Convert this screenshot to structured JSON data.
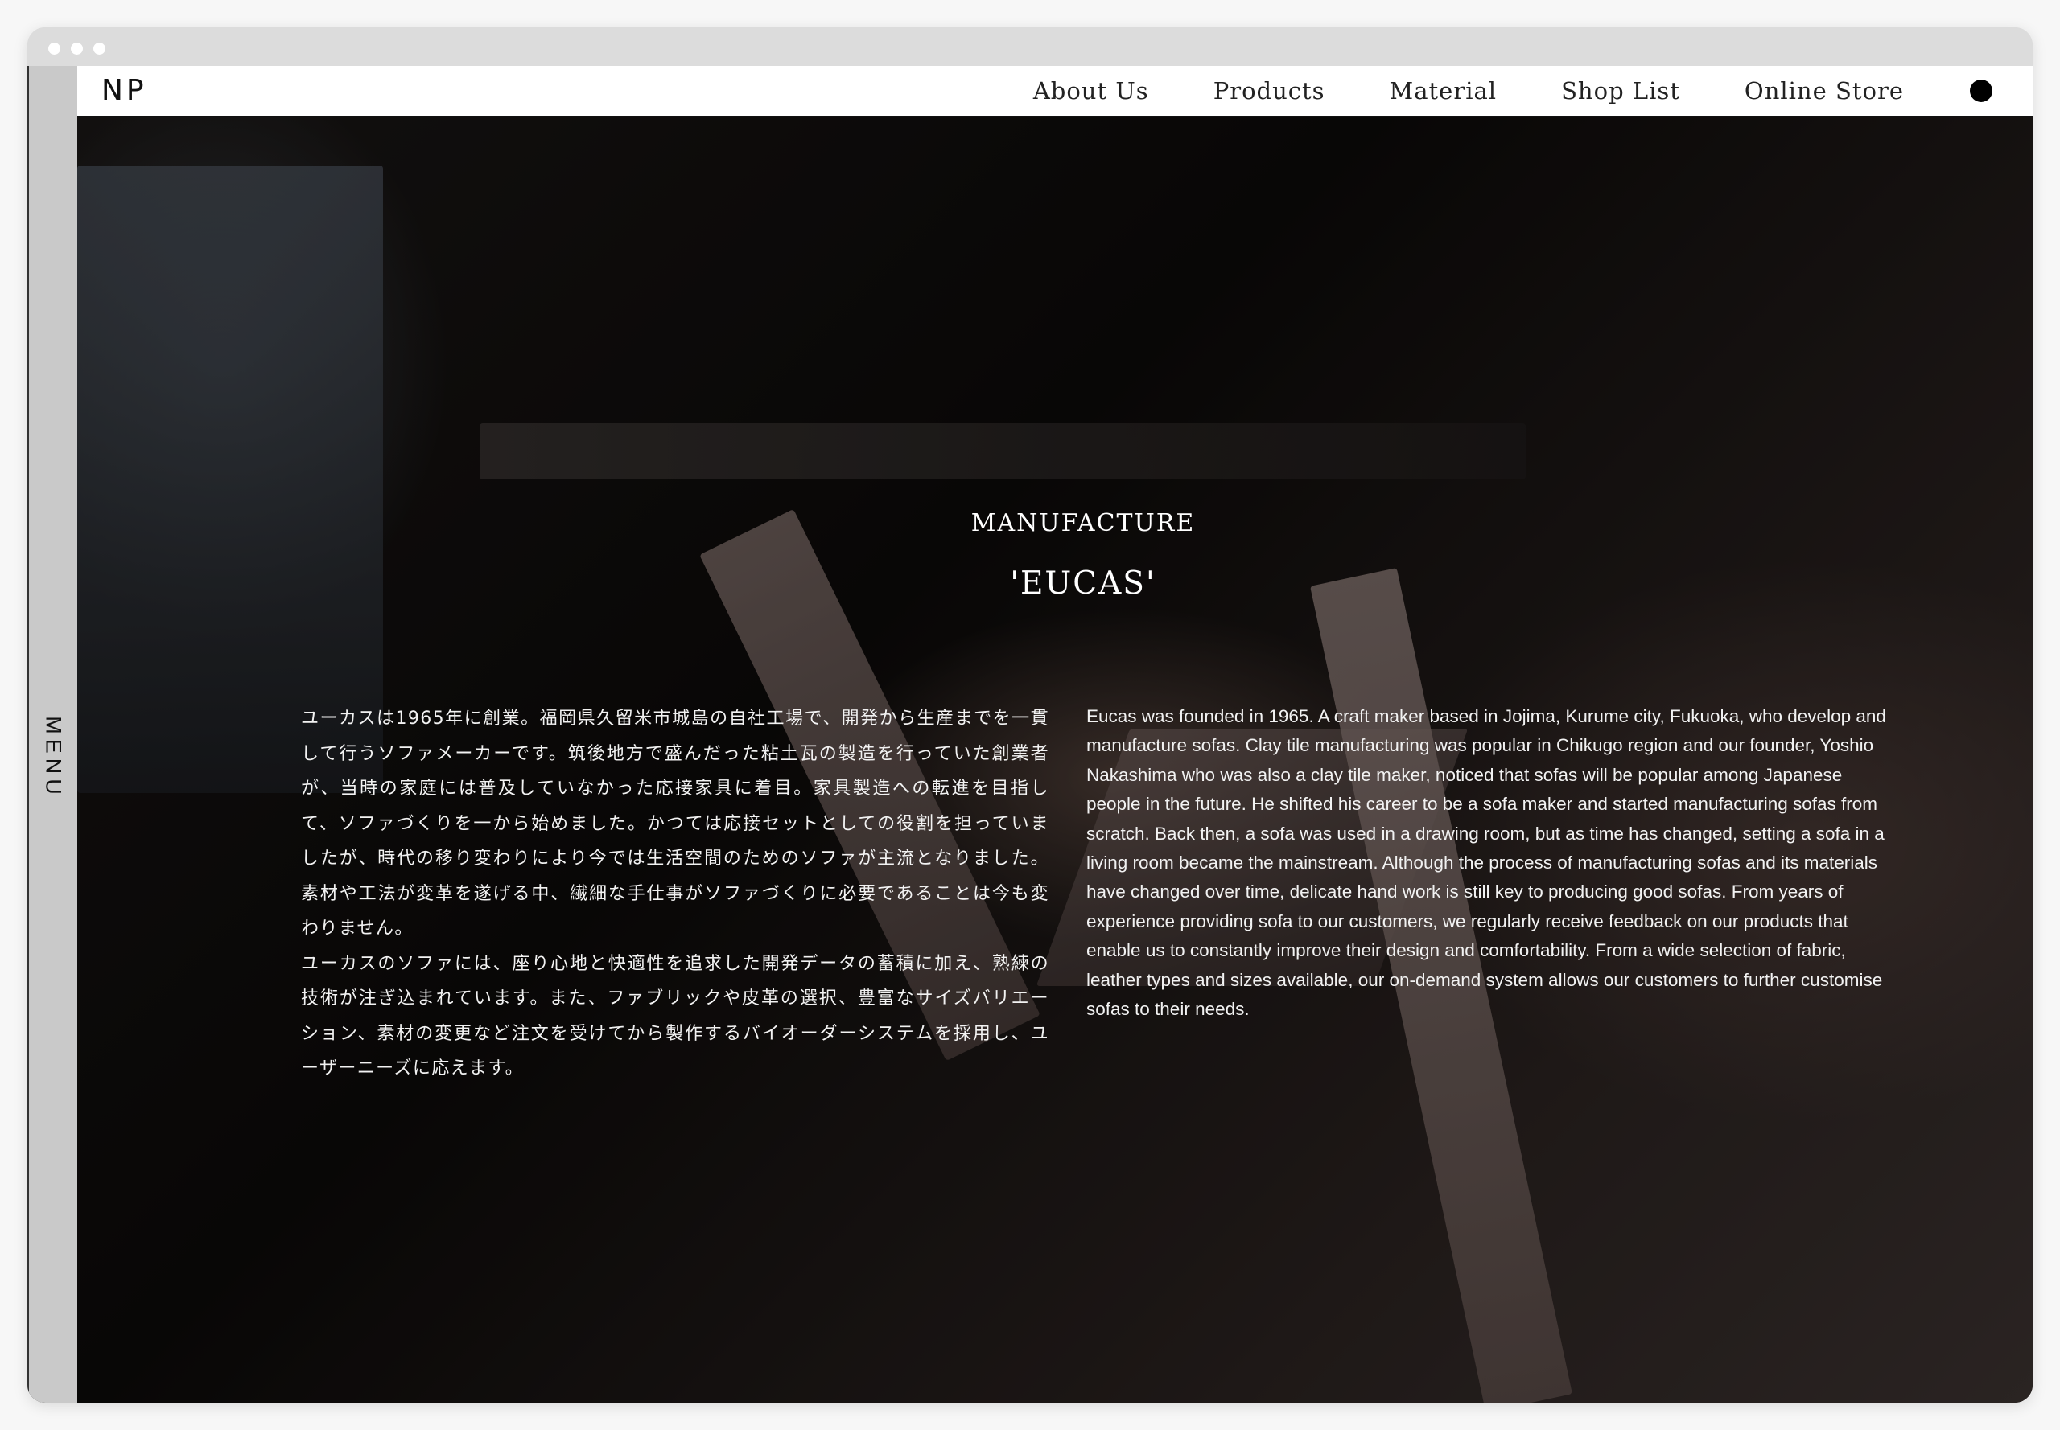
{
  "header": {
    "logo": "NP",
    "nav": [
      "About Us",
      "Products",
      "Material",
      "Shop List",
      "Online Store"
    ]
  },
  "sidebar": {
    "menu_label": "MENU"
  },
  "hero": {
    "kicker": "MANUFACTURE",
    "title": "'EUCAS'",
    "jp_paragraph_1": "ユーカスは1965年に創業。福岡県久留米市城島の自社工場で、開発から生産までを一貫して行うソファメーカーです。筑後地方で盛んだった粘土瓦の製造を行っていた創業者が、当時の家庭には普及していなかった応接家具に着目。家具製造への転進を目指して、ソファづくりを一から始めました。かつては応接セットとしての役割を担っていましたが、時代の移り変わりにより今では生活空間のためのソファが主流となりました。素材や工法が変革を遂げる中、繊細な手仕事がソファづくりに必要であることは今も変わりません。",
    "jp_paragraph_2": "ユーカスのソファには、座り心地と快適性を追求した開発データの蓄積に加え、熟練の技術が注ぎ込まれています。また、ファブリックや皮革の選択、豊富なサイズバリエーション、素材の変更など注文を受けてから製作するバイオーダーシステムを採用し、ユーザーニーズに応えます。",
    "en_paragraph": "Eucas was founded in 1965. A craft maker based in Jojima, Kurume city, Fukuoka, who develop and manufacture sofas. Clay tile manufacturing was popular in Chikugo region and our founder, Yoshio Nakashima who was also a clay tile maker, noticed that sofas will be popular among Japanese people in the future. He shifted his career to be a sofa maker and started manufacturing sofas from scratch. Back then, a sofa was used in a drawing room, but as time has changed, setting a sofa in a living room became the mainstream. Although the process of manufacturing sofas and its materials have changed over time, delicate hand work is still key to producing good sofas. From years of experience providing sofa to our customers, we regularly receive feedback on our products that enable us to constantly improve their design and comfortability. From a wide selection of fabric, leather types and sizes available, our on-demand system allows our customers to further customise sofas to their needs."
  }
}
